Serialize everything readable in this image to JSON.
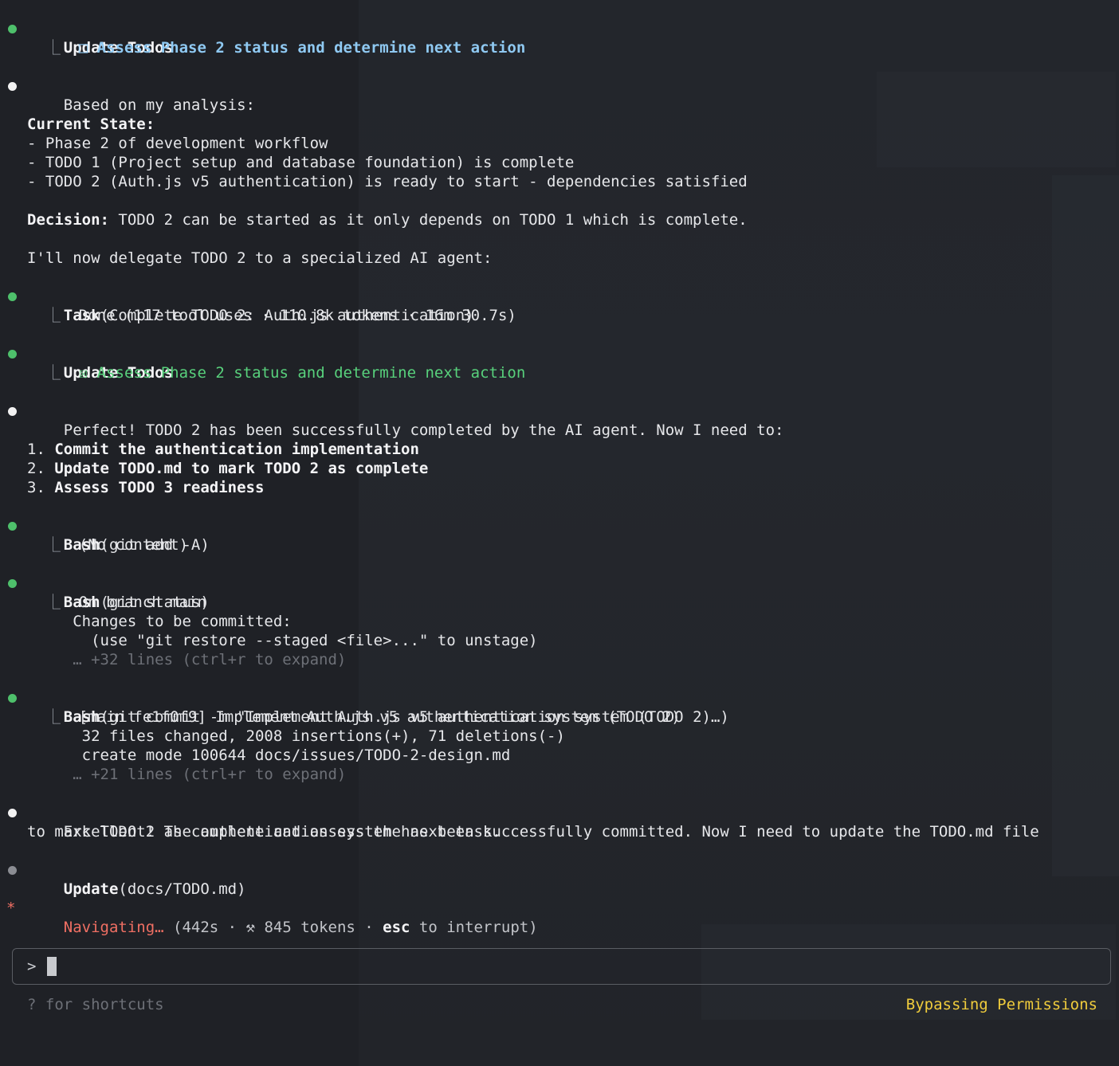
{
  "messages": {
    "m1": {
      "title": "Update Todos",
      "item_box": "□",
      "item_text": "Assess Phase 2 status and determine next action"
    },
    "m2": {
      "intro": "Based on my analysis:",
      "state_heading": "Current State:",
      "state_items": [
        "- Phase 2 of development workflow",
        "- TODO 1 (Project setup and database foundation) is complete",
        "- TODO 2 (Auth.js v5 authentication) is ready to start - dependencies satisfied"
      ],
      "decision_label": "Decision:",
      "decision_text": " TODO 2 can be started as it only depends on TODO 1 which is complete.",
      "delegate": "I'll now delegate TODO 2 to a specialized AI agent:"
    },
    "m3": {
      "tool": "Task",
      "args": "(Complete TODO 2: Auth.js authentication)",
      "result": "Done (117 tool uses · 110.8k tokens · 16m 30.7s)"
    },
    "m4": {
      "title": "Update Todos",
      "item_box": "☒",
      "item_text": "Assess Phase 2 status and determine next action"
    },
    "m5": {
      "intro": "Perfect! TODO 2 has been successfully completed by the AI agent. Now I need to:",
      "steps": [
        {
          "num": "1. ",
          "text": "Commit the authentication implementation"
        },
        {
          "num": "2. ",
          "text": "Update TODO.md to mark TODO 2 as complete"
        },
        {
          "num": "3. ",
          "text": "Assess TODO 3 readiness"
        }
      ]
    },
    "m6": {
      "tool": "Bash",
      "args": "(git add -A)",
      "result": "(No content)"
    },
    "m7": {
      "tool": "Bash",
      "args": "(git status)",
      "result1": "On branch main",
      "result2": "Changes to be committed:",
      "result3": "(use \"git restore --staged <file>...\" to unstage)",
      "more": "… +32 lines (ctrl+r to expand)"
    },
    "m8": {
      "tool": "Bash",
      "args": "(git commit -m \"Implement Auth.js v5 authentication system (TODO 2)…)",
      "result1": "[main fe1f0f9] Implement Auth.js v5 authentication system (TODO 2)",
      "result2": "32 files changed, 2008 insertions(+), 71 deletions(-)",
      "result3": "create mode 100644 docs/issues/TODO-2-design.md",
      "more": "… +21 lines (ctrl+r to expand)"
    },
    "m9": {
      "line1": "Excellent! The authentication system has been successfully committed. Now I need to update the TODO.md file",
      "line2": "to mark TODO 2 as complete and assess the next task."
    },
    "m10": {
      "tool": "Update",
      "args": "(docs/TODO.md)"
    }
  },
  "status": {
    "spinner": "*",
    "label": "Navigating…",
    "details_pre": " (442s · ⚒ 845 tokens · ",
    "esc": "esc",
    "details_post": " to interrupt)"
  },
  "input": {
    "prompt": ">",
    "value": ""
  },
  "footer": {
    "left": "? for shortcuts",
    "right": "Bypassing Permissions"
  },
  "colors": {
    "bullet_done": "#4ec06b",
    "bullet_text": "#f2f2f2",
    "bullet_pending": "#8b8d93",
    "status": "#ef6f63",
    "permissions": "#f0cc3c",
    "todo_pending": "#8fc9f2",
    "todo_done": "#58d17c"
  }
}
